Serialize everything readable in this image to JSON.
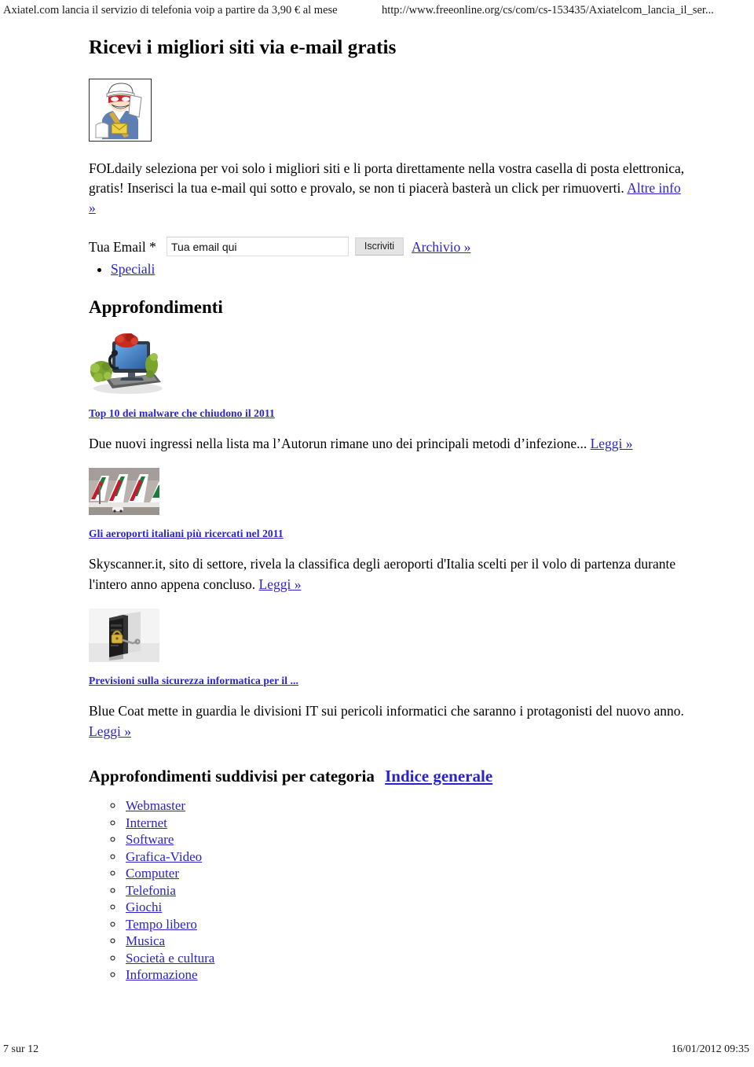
{
  "print_header": {
    "title": "Axiatel.com lancia il servizio di telefonia voip a partire da 3,90 € al mese",
    "url": "http://www.freeonline.org/cs/com/cs-153435/Axiatelcom_lancia_il_ser..."
  },
  "newsletter": {
    "headline": "Ricevi i migliori siti via e-mail gratis",
    "mascot_alt": "mailman-illustration",
    "intro": "FOLdaily seleziona per voi solo i migliori siti e li porta direttamente nella vostra casella di posta elettronica, gratis! Inserisci la tua e-mail qui sotto e provalo, se non ti piacerà basterà un click per rimuoverti.",
    "intro_link": "Altre info »",
    "email_label": "Tua Email *",
    "email_value": "Tua email qui",
    "email_placeholder": "Tua email qui",
    "submit_label": "Iscriviti",
    "archive_link": "Archivio »",
    "bullets": [
      "Speciali"
    ]
  },
  "approfondimenti": {
    "heading": "Approfondimenti",
    "articles": [
      {
        "image_alt": "malware-monitor-illustration",
        "title": "Top 10 dei malware che chiudono il 2011",
        "body": "Due nuovi ingressi nella lista ma l’Autorun rimane uno dei principali metodi d’infezione...",
        "read_more": "Leggi »"
      },
      {
        "image_alt": "alitalia-airplane-tails-photo",
        "title": "Gli aeroporti italiani più ricercati nel 2011",
        "body": "Skyscanner.it, sito di settore, rivela la classifica degli aeroporti d'Italia scelti per il volo di partenza durante l'intero anno appena concluso.",
        "read_more": "Leggi »"
      },
      {
        "image_alt": "locked-pc-tower-photo",
        "title": "Previsioni sulla sicurezza informatica per il ...",
        "body": "Blue Coat mette in guardia le divisioni IT sui pericoli informatici che saranno i protagonisti del nuovo anno.",
        "read_more": "Leggi »"
      }
    ]
  },
  "categories": {
    "heading": "Approfondimenti suddivisi per categoria",
    "index_link": "Indice generale",
    "items": [
      "Webmaster",
      "Internet",
      "Software",
      "Grafica-Video",
      "Computer",
      "Telefonia",
      "Giochi",
      "Tempo libero",
      "Musica",
      "Società e cultura",
      "Informazione"
    ]
  },
  "print_footer": {
    "page": "7 sur 12",
    "timestamp": "16/01/2012 09:35"
  },
  "colors": {
    "link": "#2a24c8",
    "text": "#000000",
    "button_bg": "#e4e4e4",
    "background": "#ffffff"
  }
}
